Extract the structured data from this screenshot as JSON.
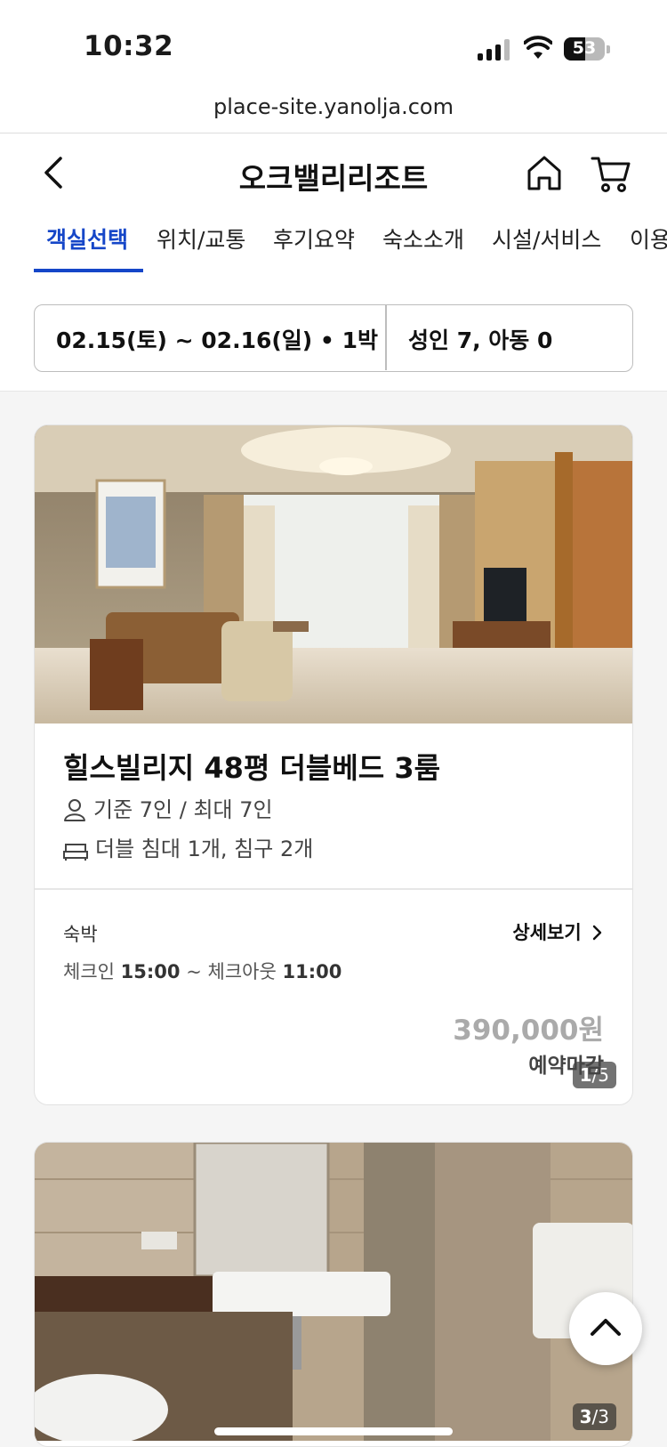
{
  "status": {
    "time": "10:32",
    "battery": "53",
    "battery_level": 0.53
  },
  "browser": {
    "url": "place-site.yanolja.com"
  },
  "header": {
    "title": "오크밸리리조트",
    "back_icon": "chevron-left-icon",
    "home_icon": "home-icon",
    "cart_icon": "cart-icon"
  },
  "tabs": [
    "객실선택",
    "위치/교통",
    "후기요약",
    "숙소소개",
    "시설/서비스",
    "이용"
  ],
  "active_tab": 0,
  "search": {
    "dates": "02.15(토) ~ 02.16(일) • 1박",
    "guests": "성인 7, 아동 0"
  },
  "rooms": [
    {
      "name": "힐스빌리지 48평 더블베드 3룸",
      "capacity": "기준 7인 / 최대 7인",
      "beds": "더블 침대 1개, 침구 2개",
      "photo_current": "1",
      "photo_total": "/5",
      "stay_type": "숙박",
      "detail_label": "상세보기",
      "checkin_label": "체크인",
      "checkin_time": "15:00",
      "separator": "~",
      "checkout_label": "체크아웃",
      "checkout_time": "11:00",
      "price": "390,000원",
      "status": "예약마감"
    },
    {
      "photo_current": "3",
      "photo_total": "/3"
    }
  ],
  "colors": {
    "accent": "#1546c8",
    "price_soldout": "#aaaaaa"
  },
  "icons": {
    "scroll_top": "chevron-up-icon",
    "person": "person-icon",
    "bed": "bed-icon"
  }
}
